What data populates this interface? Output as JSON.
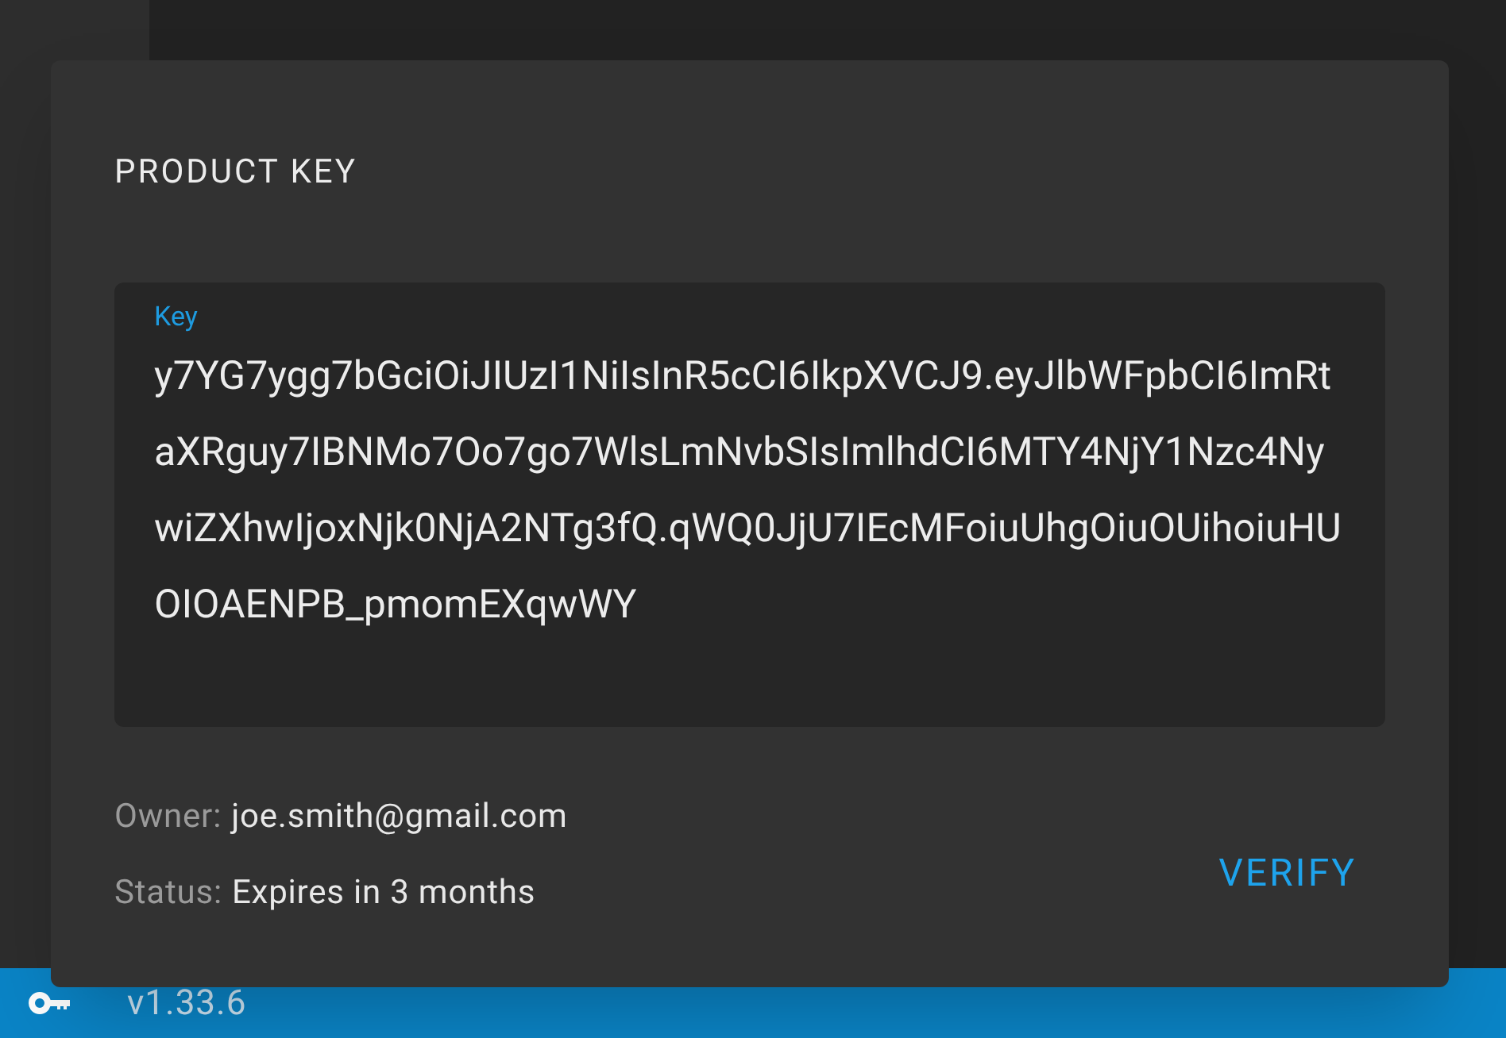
{
  "dialog": {
    "title": "PRODUCT KEY",
    "key_field": {
      "label": "Key",
      "value": "y7YG7ygg7bGciOiJIUzI1NiIsInR5cCI6IkpXVCJ9.eyJlbWFpbCI6ImRtaXRguy7IBNMo7Oo7go7WlsLmNvbSIsImlhdCI6MTY4NjY1Nzc4NywiZXhwIjoxNjk0NjA2NTg3fQ.qWQ0JjU7IEcMFoiuUhgOiuOUihoiuHUOIOAENPB_pmomEXqwWY"
    },
    "details": [
      {
        "label": "Owner:",
        "value": "joe.smith@gmail.com"
      },
      {
        "label": "Status:",
        "value": "Expires in 3 months"
      }
    ],
    "button": "VERIFY"
  },
  "status_bar": {
    "version": "v1.33.6"
  }
}
